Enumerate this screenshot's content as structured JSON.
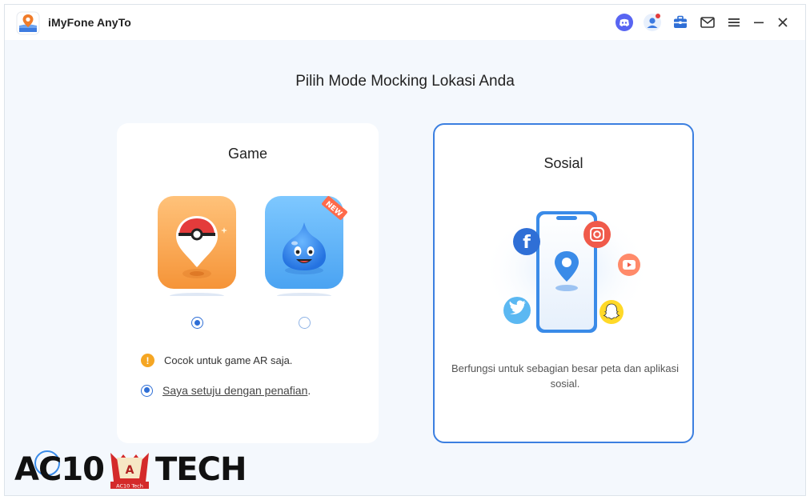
{
  "titlebar": {
    "app_name": "iMyFone AnyTo",
    "icons": [
      "discord-icon",
      "user-icon",
      "toolbox-icon",
      "mail-icon",
      "menu-icon",
      "minimize-icon",
      "close-icon"
    ]
  },
  "main": {
    "heading": "Pilih Mode Mocking Lokasi Anda"
  },
  "game_card": {
    "title": "Game",
    "games": [
      {
        "name": "pokemon-go",
        "selected": true
      },
      {
        "name": "dragon-quest-walk",
        "selected": false,
        "badge": "NEW"
      }
    ],
    "note": "Cocok untuk game AR saja.",
    "agree_text": "Saya setuju dengan penafian",
    "agree_suffix": "."
  },
  "social_card": {
    "title": "Sosial",
    "description": "Berfungsi untuk sebagian besar peta dan aplikasi sosial."
  },
  "watermark": {
    "left": "AC10",
    "right": "TECH",
    "emblem_text": "AC10 Tech"
  },
  "colors": {
    "accent": "#2f6fd6",
    "background": "#f4f8fd",
    "card_border": "#3b7fe0",
    "warning": "#f5a623"
  }
}
